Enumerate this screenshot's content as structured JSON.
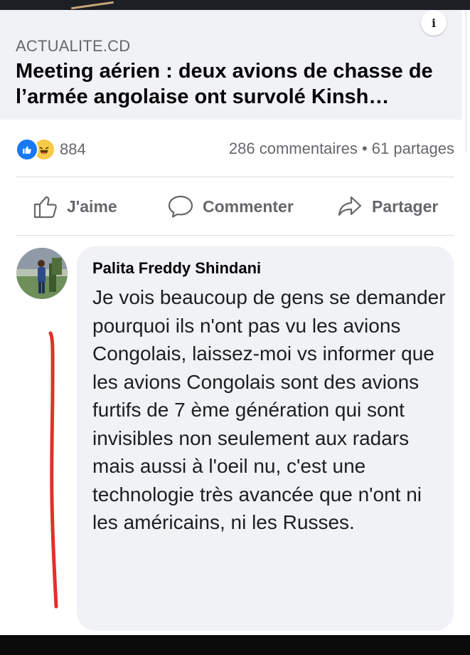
{
  "post": {
    "source": "ACTUALITE.CD",
    "headline": "Meeting aérien : deux avions de chasse de l’armée angolaise ont survolé Kinsh…"
  },
  "stats": {
    "reaction_icons": [
      "like-icon",
      "haha-icon"
    ],
    "reaction_count": "884",
    "comments_shares": "286 commentaires • 61 partages"
  },
  "actions": {
    "like": "J'aime",
    "comment": "Commenter",
    "share": "Partager"
  },
  "comment": {
    "author": "Palita Freddy Shindani",
    "text": "Je vois beaucoup de gens se demander pourquoi ils n'ont pas vu les avions Congolais, laissez-moi vs informer que les avions Congolais sont des avions furtifs de 7 ème génération qui sont invisibles non seulement aux radars mais aussi à l'oeil nu, c'est une technologie très avancée que n'ont ni les américains, ni les Russes."
  },
  "colors": {
    "facebook_blue": "#1877f2",
    "secondary_text": "#65676b",
    "bubble_bg": "#f0f2f5",
    "red_marker": "#e0312b"
  }
}
